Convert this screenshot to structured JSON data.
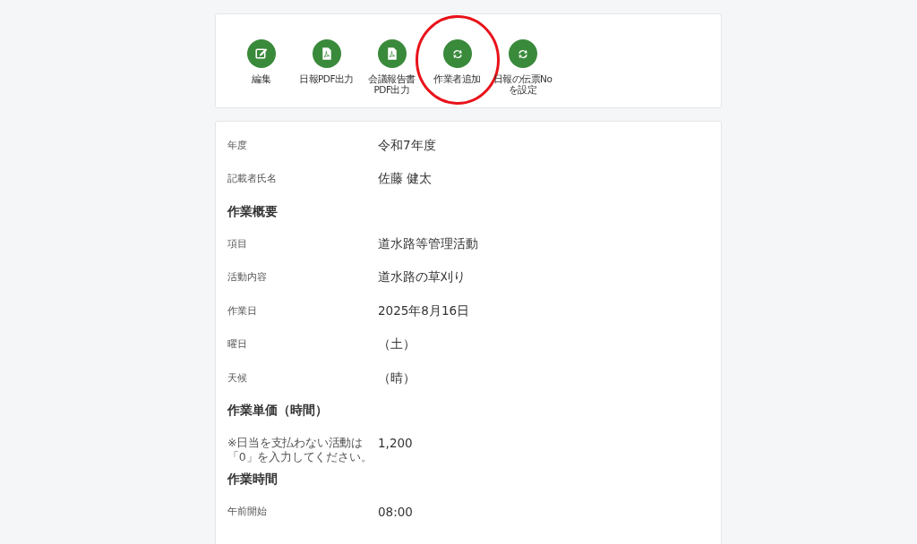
{
  "toolbar": {
    "buttons": [
      {
        "label": "編集",
        "kind": "edit",
        "circled": false
      },
      {
        "label": "日報PDF出力",
        "kind": "pdf",
        "circled": false
      },
      {
        "label": "会議報告書\nPDF出力",
        "kind": "pdf",
        "circled": false
      },
      {
        "label": "作業者追加",
        "kind": "cycle",
        "circled": true
      },
      {
        "label": "日報の伝票No\nを設定",
        "kind": "cycle",
        "circled": false
      }
    ]
  },
  "details": [
    {
      "kind": "field",
      "label": "年度",
      "value": "令和7年度"
    },
    {
      "kind": "field",
      "label": "記載者氏名",
      "value": "佐藤 健太"
    },
    {
      "kind": "section",
      "label": "作業概要"
    },
    {
      "kind": "field",
      "label": "項目",
      "value": "道水路等管理活動"
    },
    {
      "kind": "field",
      "label": "活動内容",
      "value": "道水路の草刈り"
    },
    {
      "kind": "field",
      "label": "作業日",
      "value": "2025年8月16日"
    },
    {
      "kind": "field",
      "label": "曜日",
      "value": "（土）"
    },
    {
      "kind": "field",
      "label": "天候",
      "value": "（晴）"
    },
    {
      "kind": "section",
      "label": "作業単価（時間）"
    },
    {
      "kind": "note_field",
      "label_lines": [
        "※日当を支払わない活動は",
        "「0」を入力してください。"
      ],
      "value": "1,200"
    },
    {
      "kind": "section",
      "label": "作業時間"
    },
    {
      "kind": "field",
      "label": "午前開始",
      "value": "08:00"
    }
  ]
}
